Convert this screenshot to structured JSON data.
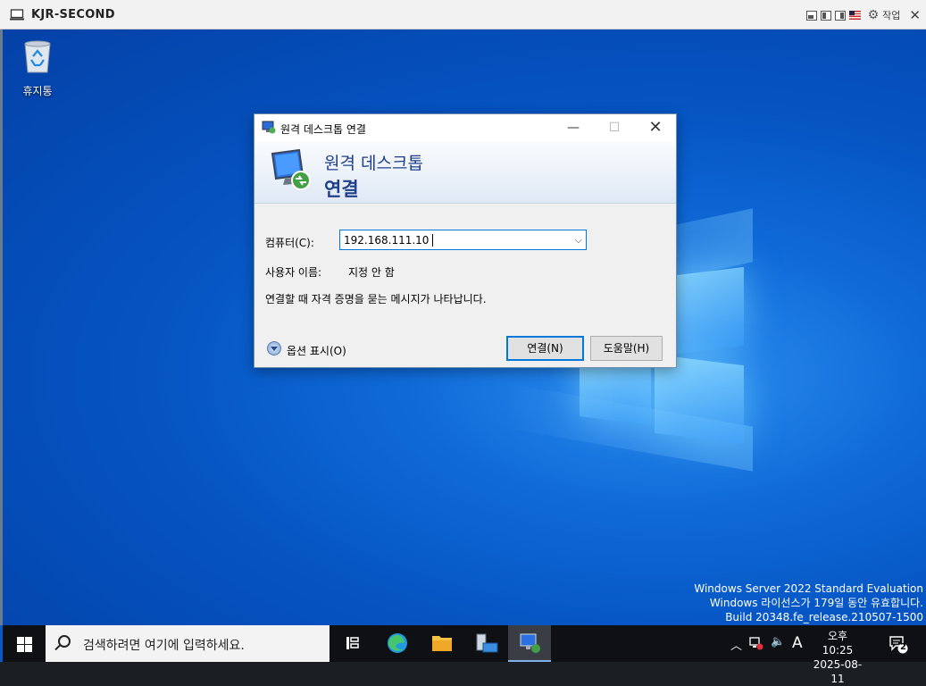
{
  "vm": {
    "title": "KJR-SECOND",
    "menu_label": "작업"
  },
  "desktop": {
    "recycle_label": "휴지통",
    "watermark": [
      "Windows Server 2022 Standard Evaluation",
      "Windows 라이선스가 179일 동안 유효합니다.",
      "Build 20348.fe_release.210507-1500"
    ]
  },
  "dialog": {
    "title": "원격 데스크톱 연결",
    "header_line1": "원격 데스크톱",
    "header_line2": "연결",
    "computer_label": "컴퓨터(C):",
    "computer_value": "192.168.111.10",
    "username_label": "사용자 이름:",
    "username_value": "지정 안 함",
    "info_text": "연결할 때 자격 증명을 묻는 메시지가 나타납니다.",
    "options_label": "옵션 표시(O)",
    "connect_button": "연결(N)",
    "help_button": "도움말(H)"
  },
  "taskbar": {
    "search_placeholder": "검색하려면 여기에 입력하세요.",
    "items": [
      "task-view-icon",
      "edge-icon",
      "file-explorer-icon",
      "server-manager-icon",
      "remote-desktop-icon"
    ],
    "ime_indicator": "A",
    "clock_time": "오후 10:25",
    "clock_date": "2025-08-11",
    "notification_count": "2"
  },
  "colors": {
    "desktop_blue": "#0554c2",
    "dialog_header_text": "#1f3f8a",
    "focus_blue": "#0078d7",
    "taskbar": "#0f1014"
  }
}
